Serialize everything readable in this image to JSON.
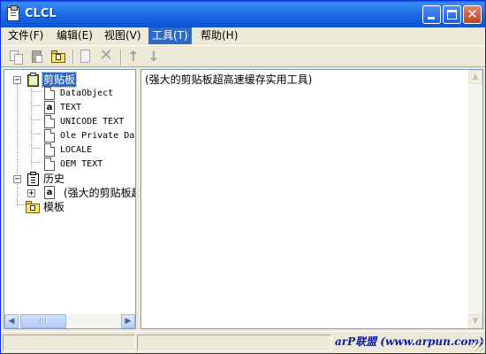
{
  "window": {
    "title": "CLCL"
  },
  "menu": [
    {
      "label": "文件(F)",
      "active": false
    },
    {
      "label": "编辑(E)",
      "active": false
    },
    {
      "label": "视图(V)",
      "active": false
    },
    {
      "label": "工具(T)",
      "active": true
    },
    {
      "label": "帮助(H)",
      "active": false
    }
  ],
  "toolbar": {
    "icons": [
      "copy-icon",
      "paste-icon",
      "folder-clipboard-icon",
      "new-document-icon",
      "delete-icon",
      "move-up-icon",
      "move-down-icon"
    ],
    "enabled": [
      "paste-icon",
      "folder-clipboard-icon"
    ]
  },
  "tree": {
    "clipboard": {
      "label": "剪贴板",
      "expanded": true,
      "selected": true,
      "formats": [
        "DataObject",
        "TEXT",
        "UNICODE TEXT",
        "Ole Private Da",
        "LOCALE",
        "OEM TEXT"
      ]
    },
    "history": {
      "label": "历史",
      "expanded": true,
      "items": [
        "(强大的剪贴板超"
      ]
    },
    "template": {
      "label": "模板"
    }
  },
  "content": {
    "text": "(强大的剪贴板超高速缓存实用工具)"
  },
  "statusbar": {
    "watermark": "arP联盟 (www.arpun.com)"
  },
  "colors": {
    "title_bar": "#0a54d4",
    "selection": "#316ac5",
    "window_bg": "#ece9d8"
  }
}
